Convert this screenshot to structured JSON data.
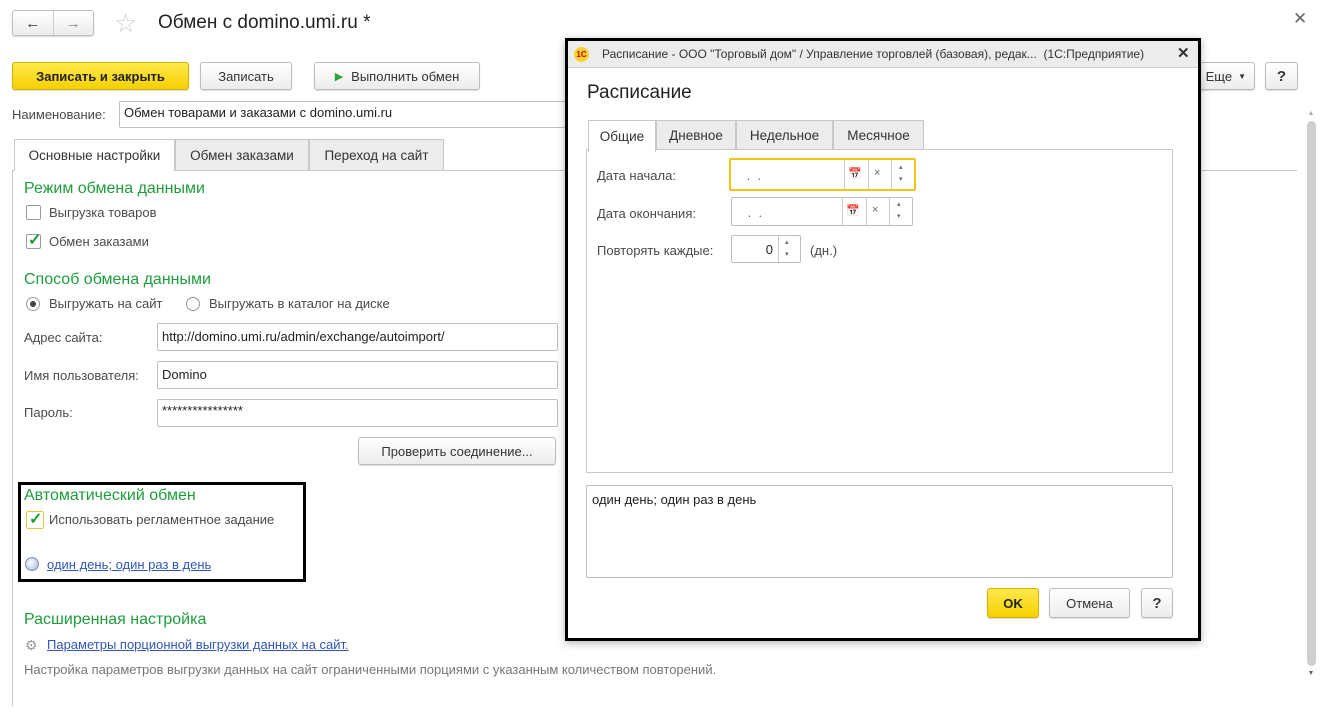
{
  "window": {
    "title": "Обмен с domino.umi.ru *"
  },
  "toolbar": {
    "save_close": "Записать и закрыть",
    "save": "Записать",
    "run_exchange": "Выполнить обмен",
    "more": "Еще",
    "help": "?"
  },
  "name_field": {
    "label": "Наименование:",
    "value": "Обмен товарами и заказами с domino.umi.ru"
  },
  "tabs": [
    {
      "label": "Основные настройки"
    },
    {
      "label": "Обмен заказами"
    },
    {
      "label": "Переход на сайт"
    }
  ],
  "mode": {
    "heading": "Режим обмена данными",
    "export_goods": "Выгрузка товаров",
    "exchange_orders": "Обмен заказами"
  },
  "method": {
    "heading": "Способ обмена данными",
    "radio_site": "Выгружать на сайт",
    "radio_disk": "Выгружать в каталог на диске",
    "address_label": "Адрес сайта:",
    "address": "http://domino.umi.ru/admin/exchange/autoimport/",
    "user_label": "Имя пользователя:",
    "user": "Domino",
    "password_label": "Пароль:",
    "password": "****************",
    "check_button": "Проверить соединение..."
  },
  "auto": {
    "heading": "Автоматический обмен",
    "use_task": "Использовать регламентное задание",
    "schedule_link": "один день; один раз в день"
  },
  "advanced": {
    "heading": "Расширенная настройка",
    "link": "Параметры порционной выгрузки данных на сайт.",
    "note": "Настройка параметров выгрузки данных на сайт ограниченными порциями с указанным количеством повторений."
  },
  "dialog": {
    "title": "Расписание - ООО \"Торговый дом\" / Управление торговлей (базовая), редак...  (1С:Предприятие)",
    "heading": "Расписание",
    "tabs": [
      {
        "label": "Общие"
      },
      {
        "label": "Дневное"
      },
      {
        "label": "Недельное"
      },
      {
        "label": "Месячное"
      }
    ],
    "start_label": "Дата начала:",
    "start_value": " .  .",
    "end_label": "Дата окончания:",
    "end_value": " .  .",
    "repeat_label": "Повторять каждые:",
    "repeat_value": "0",
    "repeat_unit": "(дн.)",
    "summary": "один день; один раз в день",
    "ok": "OK",
    "cancel": "Отмена",
    "help": "?"
  }
}
